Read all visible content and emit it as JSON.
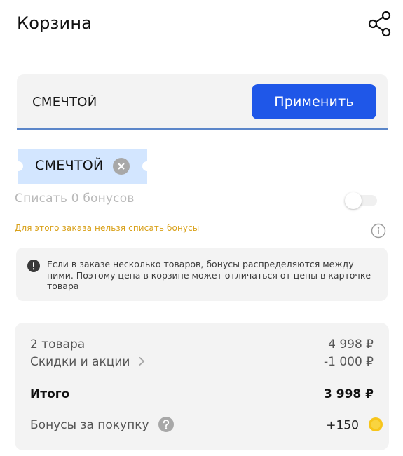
{
  "header": {
    "title": "Корзина",
    "share_icon": "share-icon"
  },
  "promo": {
    "input_value": "СМЕЧТОЙ",
    "apply_label": "Применить",
    "applied_code": "СМЕЧТОЙ",
    "remove_icon": "close-icon"
  },
  "bonus": {
    "toggle_label": "Списать 0 бонусов",
    "toggle_on": false,
    "warning": "Для этого заказа нельзя списать бонусы",
    "info_icon": "info-icon"
  },
  "notice": {
    "icon": "exclamation-icon",
    "text": "Если в заказе несколько товаров, бонусы распределяются между ними. Поэтому цена в корзине может отличаться от цены в карточке товара"
  },
  "summary": {
    "items_label": "2 товара",
    "items_value": "4 998 ₽",
    "discount_label": "Скидки и акции",
    "discount_value": "-1 000 ₽",
    "total_label": "Итого",
    "total_value": "3 998 ₽",
    "bonus_label": "Бонусы за покупку",
    "bonus_value": "+150"
  },
  "colors": {
    "accent": "#1f57e8",
    "warning": "#d9a11a",
    "chip": "#d3e6ff",
    "coin": "#f7c51a"
  }
}
